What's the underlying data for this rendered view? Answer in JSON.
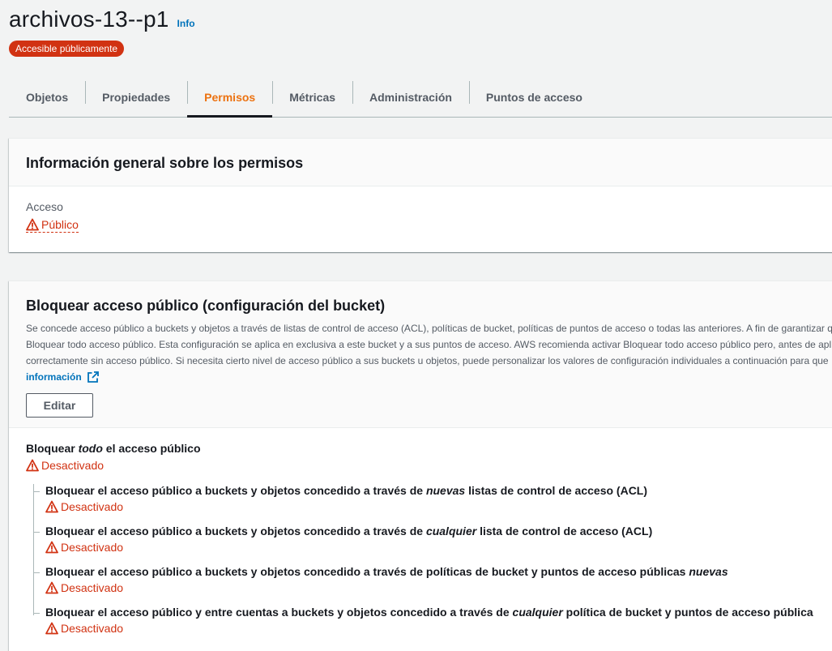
{
  "header": {
    "bucket_name": "archivos-13--p1",
    "info_link": "Info",
    "public_badge": "Accesible públicamente"
  },
  "tabs": [
    {
      "label": "Objetos",
      "active": false
    },
    {
      "label": "Propiedades",
      "active": false
    },
    {
      "label": "Permisos",
      "active": true
    },
    {
      "label": "Métricas",
      "active": false
    },
    {
      "label": "Administración",
      "active": false
    },
    {
      "label": "Puntos de acceso",
      "active": false
    }
  ],
  "overview": {
    "title": "Información general sobre los permisos",
    "access_label": "Acceso",
    "access_value": "Público",
    "access_icon": "warning-icon"
  },
  "block_public_access": {
    "title": "Bloquear acceso público (configuración del bucket)",
    "description_lines": [
      "Se concede acceso público a buckets y objetos a través de listas de control de acceso (ACL), políticas de bucket, políticas de puntos de acceso o todas las anteriores. A fin de garantizar q",
      "Bloquear todo acceso público. Esta configuración se aplica en exclusiva a este bucket y a sus puntos de acceso. AWS recomienda activar Bloquear todo acceso público pero, antes de apl",
      "correctamente sin acceso público. Si necesita cierto nivel de acceso público a sus buckets u objetos, puede personalizar los valores de configuración individuales a continuación para que"
    ],
    "more_info_link": "información",
    "edit_button": "Editar",
    "main_setting": {
      "title_before": "Bloquear ",
      "title_em": "todo",
      "title_after": " el acceso público",
      "status": "Desactivado"
    },
    "sub_settings": [
      {
        "title_before": "Bloquear el acceso público a buckets y objetos concedido a través de ",
        "title_em": "nuevas",
        "title_after": " listas de control de acceso (ACL)",
        "status": "Desactivado"
      },
      {
        "title_before": "Bloquear el acceso público a buckets y objetos concedido a través de ",
        "title_em": "cualquier",
        "title_after": " lista de control de acceso (ACL)",
        "status": "Desactivado"
      },
      {
        "title_before": "Bloquear el acceso público a buckets y objetos concedido a través de políticas de bucket y puntos de acceso públicas ",
        "title_em": "nuevas",
        "title_after": "",
        "status": "Desactivado"
      },
      {
        "title_before": "Bloquear el acceso público y entre cuentas a buckets y objetos concedido a través de ",
        "title_em": "cualquier",
        "title_after": " política de bucket y puntos de acceso pública",
        "status": "Desactivado"
      }
    ]
  },
  "colors": {
    "accent_orange": "#ec7211",
    "danger_red": "#d13212",
    "link_blue": "#0073bb",
    "text_dark": "#16191f",
    "text_muted": "#545b64"
  }
}
